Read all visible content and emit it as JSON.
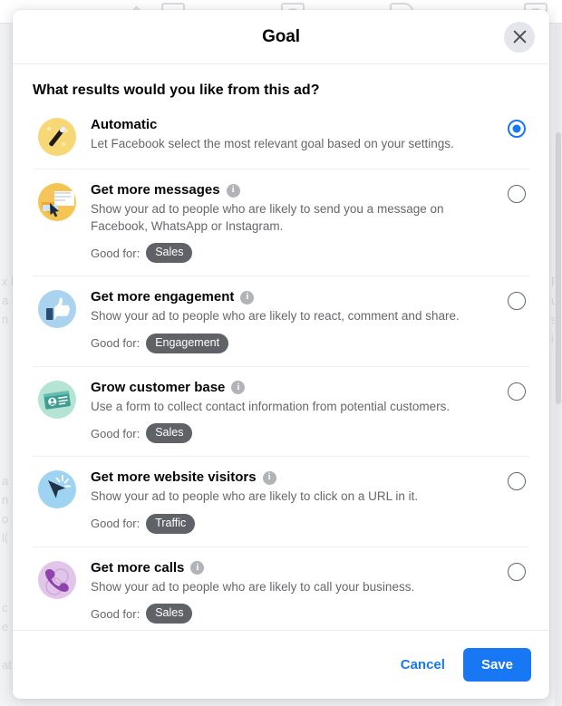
{
  "modal": {
    "title": "Goal",
    "close_icon": "close-icon",
    "question": "What results would you like from this ad?",
    "good_for_label": "Good for:",
    "options": [
      {
        "id": "automatic",
        "icon": "magic-wand-icon",
        "title": "Automatic",
        "has_info": false,
        "description": "Let Facebook select the most relevant goal based on your settings.",
        "good_for": null,
        "selected": true
      },
      {
        "id": "messages",
        "icon": "envelope-cursor-icon",
        "title": "Get more messages",
        "has_info": true,
        "description": "Show your ad to people who are likely to send you a message on Facebook, WhatsApp or Instagram.",
        "good_for": "Sales",
        "selected": false
      },
      {
        "id": "engagement",
        "icon": "thumbs-up-icon",
        "title": "Get more engagement",
        "has_info": true,
        "description": "Show your ad to people who are likely to react, comment and share.",
        "good_for": "Engagement",
        "selected": false
      },
      {
        "id": "customer-base",
        "icon": "id-card-icon",
        "title": "Grow customer base",
        "has_info": true,
        "description": "Use a form to collect contact information from potential customers.",
        "good_for": "Sales",
        "selected": false
      },
      {
        "id": "website-visitors",
        "icon": "cursor-click-icon",
        "title": "Get more website visitors",
        "has_info": true,
        "description": "Show your ad to people who are likely to click on a URL in it.",
        "good_for": "Traffic",
        "selected": false
      },
      {
        "id": "calls",
        "icon": "phone-handset-icon",
        "title": "Get more calls",
        "has_info": true,
        "description": "Show your ad to people who are likely to call your business.",
        "good_for": "Sales",
        "selected": false
      }
    ],
    "footer": {
      "cancel_label": "Cancel",
      "save_label": "Save"
    }
  },
  "colors": {
    "accent": "#1877f2",
    "badge": "#5f6368",
    "text_primary": "#050505",
    "text_secondary": "#65676b",
    "info_icon": "#b0b3b8",
    "icon_automatic_bg": "#f7d877",
    "icon_messages_bg": "#f2c14e",
    "icon_engagement_bg": "#aed5ef",
    "icon_customer_bg": "#b7e4d5",
    "icon_website_bg": "#9fd4f0",
    "icon_calls_bg": "#e0c4e8"
  }
}
